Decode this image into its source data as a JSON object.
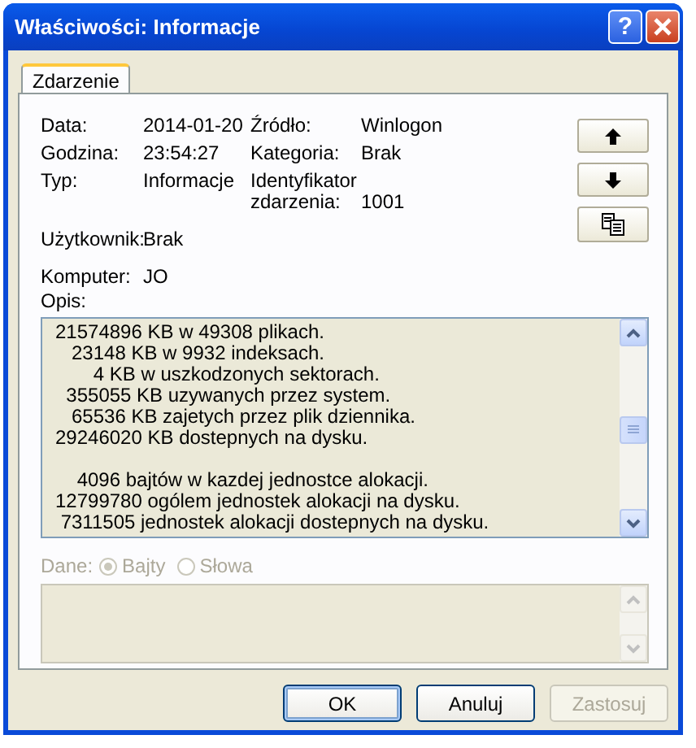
{
  "window": {
    "title": "Właściwości: Informacje",
    "help_button": "?"
  },
  "tabs": [
    {
      "label": "Zdarzenie",
      "selected": true
    }
  ],
  "fields": [
    {
      "label": "Data:",
      "value": "2014-01-20",
      "label_2": "Źródło:",
      "value_2": "Winlogon"
    },
    {
      "label": "Godzina:",
      "value": "23:54:27",
      "label_2": "Kategoria:",
      "value_2": "Brak"
    },
    {
      "label": "Typ:",
      "value": "Informacje",
      "label_2": "Identyfikator zdarzenia:",
      "value_2": "1001"
    }
  ],
  "fields_bottom": [
    {
      "label": "Użytkownik:",
      "value": "Brak"
    },
    {
      "label": "Komputer:",
      "value": "JO"
    }
  ],
  "description": {
    "label": "Opis:",
    "paragraphs": [
      [
        "21574896 KB w 49308 plikach.",
        "   23148 KB w 9932 indeksach.",
        "       4 KB w uszkodzonych sektorach.",
        "  355055 KB uzywanych przez system.",
        "   65536 KB zajetych przez plik dziennika.",
        "29246020 KB dostepnych na dysku."
      ],
      [
        "    4096 bajtów w kazdej jednostce alokacji.",
        "12799780 ogólem jednostek alokacji na dysku.",
        " 7311505 jednostek alokacji dostepnych na dysku."
      ]
    ]
  },
  "data_section": {
    "label": "Dane:",
    "disabled": true,
    "options": [
      {
        "label": "Bajty",
        "selected": true
      },
      {
        "label": "Słowa",
        "selected": false
      }
    ]
  },
  "buttons": [
    {
      "label": "OK",
      "default": true,
      "disabled": false
    },
    {
      "label": "Anuluj",
      "default": false,
      "disabled": false
    },
    {
      "label": "Zastosuj",
      "default": false,
      "disabled": true
    }
  ]
}
